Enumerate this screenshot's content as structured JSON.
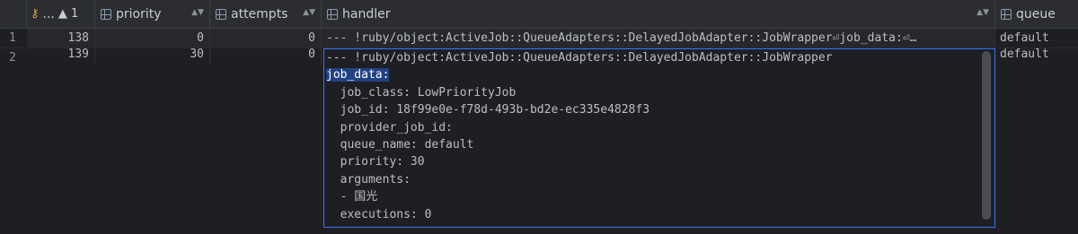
{
  "headers": {
    "id": "... ",
    "id_sort": "▲ 1",
    "priority": "priority",
    "attempts": "attempts",
    "handler": "handler",
    "queue": "queue"
  },
  "rows": [
    {
      "num": "1",
      "id": "138",
      "priority": "0",
      "attempts": "0",
      "handler": "--- !ruby/object:ActiveJob::QueueAdapters::DelayedJobAdapter::JobWrapper⏎job_data:⏎…",
      "queue": "default"
    },
    {
      "num": "2",
      "id": "139",
      "priority": "30",
      "attempts": "0",
      "queue": "default"
    }
  ],
  "editor": {
    "lines": [
      "--- !ruby/object:ActiveJob::QueueAdapters::DelayedJobAdapter::JobWrapper",
      "job_data:",
      "  job_class: LowPriorityJob",
      "  job_id: 18f99e0e-f78d-493b-bd2e-ec335e4828f3",
      "  provider_job_id:",
      "  queue_name: default",
      "  priority: 30",
      "  arguments:",
      "  - 国光",
      "  executions: 0"
    ]
  }
}
